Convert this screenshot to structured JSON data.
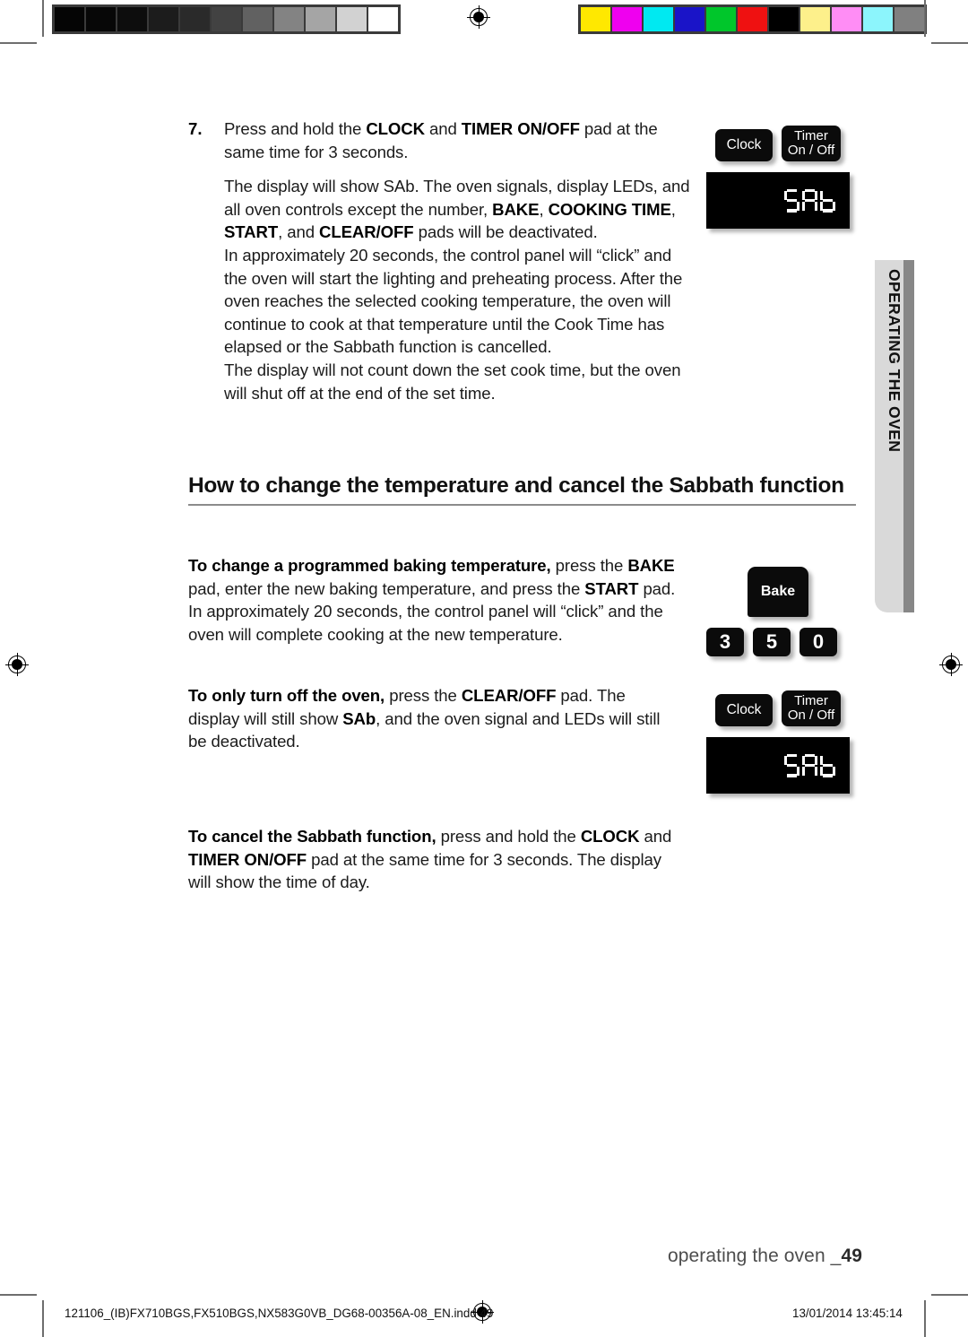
{
  "page": {
    "section_tab": "OPERATING THE OVEN",
    "footer_label": "operating the oven _",
    "footer_page_number": "49",
    "print_slug": "121106_(IB)FX710BGS,FX510BGS,NX583G0VB_DG68-00356A-08_EN.indd   49",
    "print_timestamp": "13/01/2014   13:45:14"
  },
  "step7": {
    "number": "7.",
    "paragraph_1": [
      {
        "t": "Press and hold the ",
        "b": false
      },
      {
        "t": "CLOCK",
        "b": true
      },
      {
        "t": " and ",
        "b": false
      },
      {
        "t": "TIMER ON/OFF",
        "b": true
      },
      {
        "t": " pad at the same time for 3 seconds.",
        "b": false
      }
    ],
    "paragraph_2": [
      {
        "t": "The display will show SAb. The oven signals, display LEDs, and all oven controls except the number, ",
        "b": false
      },
      {
        "t": "BAKE",
        "b": true
      },
      {
        "t": ", ",
        "b": false
      },
      {
        "t": "COOKING TIME",
        "b": true
      },
      {
        "t": ", ",
        "b": false
      },
      {
        "t": "START",
        "b": true
      },
      {
        "t": ", and ",
        "b": false
      },
      {
        "t": "CLEAR/OFF",
        "b": true
      },
      {
        "t": " pads will be deactivated.",
        "b": false
      }
    ],
    "paragraph_3": [
      {
        "t": "In approximately 20 seconds, the control panel will “click” and the oven will start the lighting and preheating process. After the oven reaches the selected cooking temperature, the oven will continue to cook at that temperature until the Cook Time has elapsed or the Sabbath function is cancelled.",
        "b": false
      }
    ],
    "paragraph_4": [
      {
        "t": "The display will not count down the set cook time, but the oven will shut off at the end of the set time.",
        "b": false
      }
    ]
  },
  "heading": {
    "title": "How to change the temperature and cancel the Sabbath function"
  },
  "para_bake": [
    {
      "t": "To change a programmed baking temperature,",
      "b": true
    },
    {
      "t": " press the ",
      "b": false
    },
    {
      "t": "BAKE",
      "b": true
    },
    {
      "t": " pad, enter the new baking temperature, and press the ",
      "b": false
    },
    {
      "t": "START",
      "b": true
    },
    {
      "t": " pad. In approximately 20 seconds, the control panel will “click” and the oven will complete cooking at the new temperature.",
      "b": false
    }
  ],
  "para_turn_off": [
    {
      "t": "To only turn off the oven,",
      "b": true
    },
    {
      "t": " press the ",
      "b": false
    },
    {
      "t": "CLEAR/OFF",
      "b": true
    },
    {
      "t": " pad. The display will still show ",
      "b": false
    },
    {
      "t": "SAb",
      "b": true
    },
    {
      "t": ", and the oven signal and LEDs will still be deactivated.",
      "b": false
    }
  ],
  "para_cancel": [
    {
      "t": "To cancel the Sabbath function,",
      "b": true
    },
    {
      "t": " press and hold the ",
      "b": false
    },
    {
      "t": "CLOCK",
      "b": true
    },
    {
      "t": " and ",
      "b": false
    },
    {
      "t": "TIMER ON/OFF",
      "b": true
    },
    {
      "t": " pad at the same time for 3 seconds. The display will show the time of day.",
      "b": false
    }
  ],
  "illustrations": {
    "clock_pad_label": "Clock",
    "timer_pad_line1": "Timer",
    "timer_pad_line2": "On / Off",
    "bake_pad_label": "Bake",
    "number_pads": [
      "3",
      "5",
      "0"
    ],
    "display_value_1": "SAb",
    "display_value_2": "SAb"
  },
  "calibration": {
    "gray_patches": [
      "#050505",
      "#070707",
      "#0d0d0d",
      "#1c1c1c",
      "#2a2a2a",
      "#424242",
      "#616161",
      "#838383",
      "#a5a5a5",
      "#d2d2d2",
      "#ffffff"
    ],
    "color_patches": [
      "#ffe800",
      "#ef00ef",
      "#00e9f1",
      "#1a14c8",
      "#00c62b",
      "#ef1111",
      "#000000",
      "#fdf08b",
      "#ff8df5",
      "#8cf5fc",
      "#808080"
    ]
  }
}
